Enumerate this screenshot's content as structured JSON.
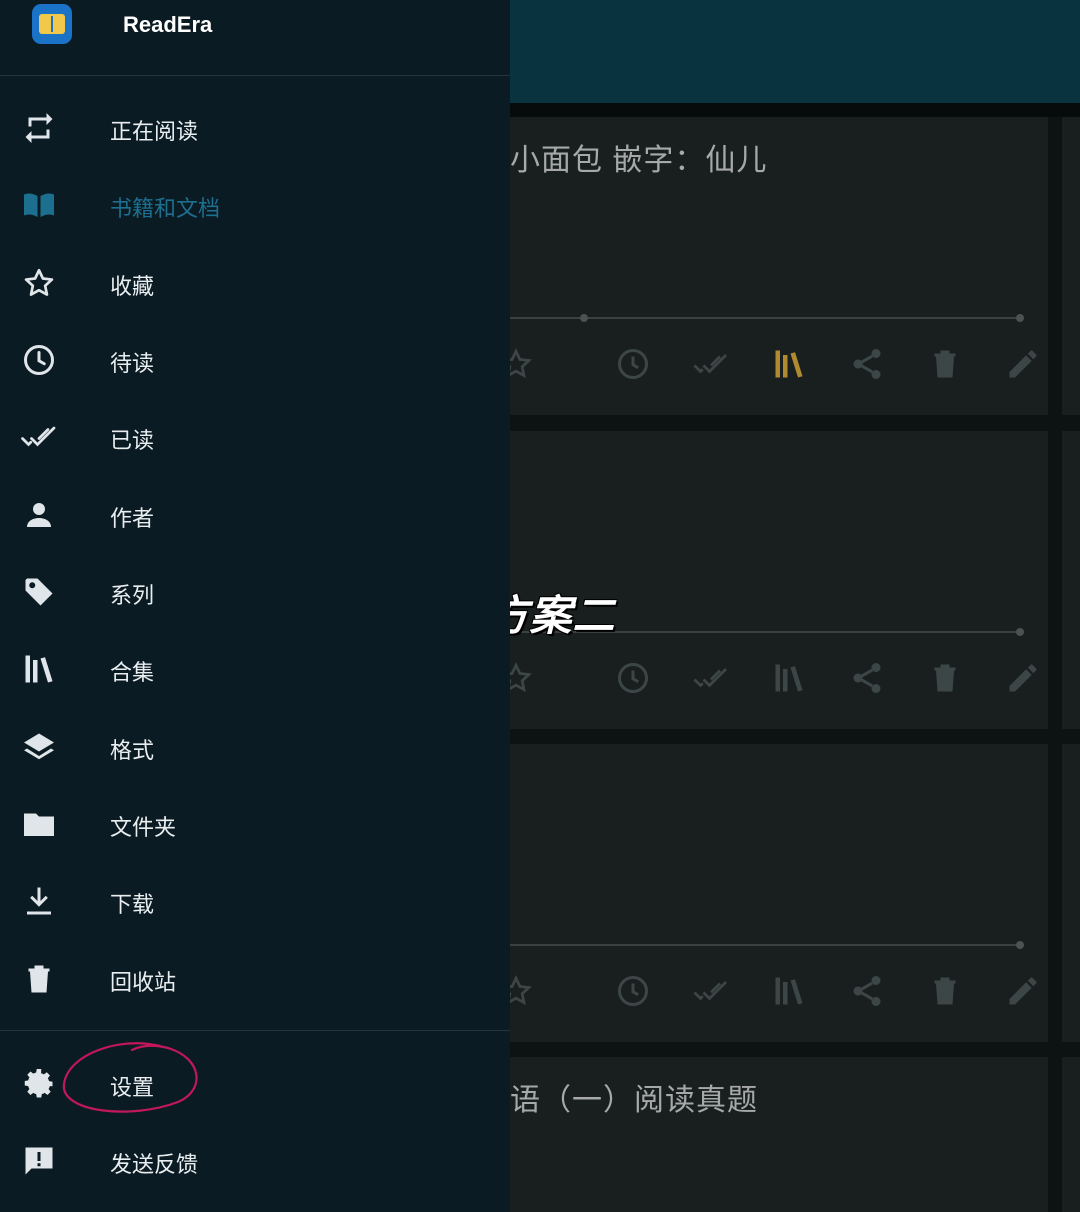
{
  "app": {
    "name": "ReadEra"
  },
  "drawer": {
    "items": [
      {
        "label": "正在阅读",
        "icon": "repeat-icon"
      },
      {
        "label": "书籍和文档",
        "icon": "open-book-icon",
        "active": true
      },
      {
        "label": "收藏",
        "icon": "star-outline-icon"
      },
      {
        "label": "待读",
        "icon": "clock-icon"
      },
      {
        "label": "已读",
        "icon": "double-check-icon"
      },
      {
        "label": "作者",
        "icon": "person-icon"
      },
      {
        "label": "系列",
        "icon": "tag-icon"
      },
      {
        "label": "合集",
        "icon": "library-icon"
      },
      {
        "label": "格式",
        "icon": "layers-icon"
      },
      {
        "label": "文件夹",
        "icon": "folder-icon"
      },
      {
        "label": "下载",
        "icon": "download-icon"
      },
      {
        "label": "回收站",
        "icon": "trash-icon"
      }
    ],
    "footer": [
      {
        "label": "设置",
        "icon": "gear-icon"
      },
      {
        "label": "发送反馈",
        "icon": "feedback-icon"
      }
    ]
  },
  "background": {
    "cards": [
      {
        "title": "小面包 嵌字：仙儿"
      },
      {
        "title": ""
      },
      {
        "title": ""
      },
      {
        "title": "语（一）阅读真题"
      }
    ]
  },
  "overlay": {
    "text": "#方案二"
  },
  "colors": {
    "drawer_bg": "#0b1b23",
    "active": "#1c6f8e",
    "annotation_ring": "#c2185b",
    "collection_highlight": "#b08a2e"
  }
}
